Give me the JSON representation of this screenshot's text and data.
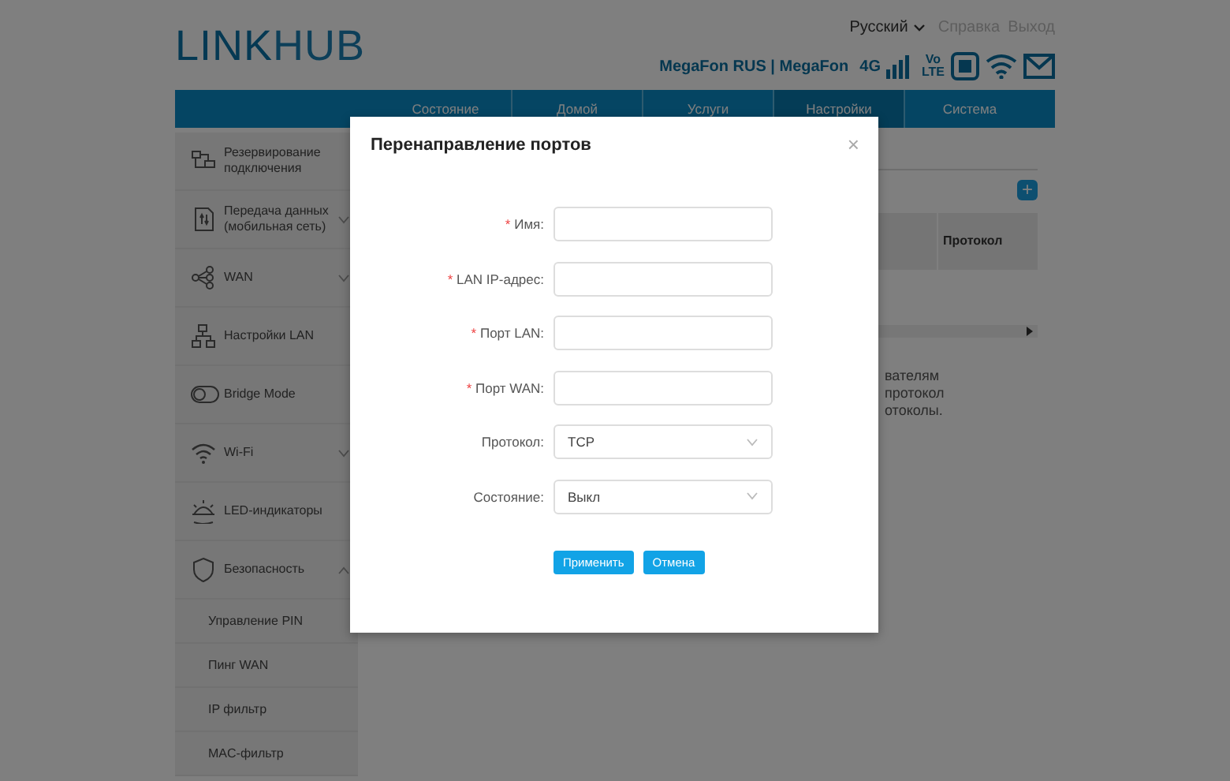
{
  "header": {
    "logo_bold": "LINK",
    "logo_light": "HUB",
    "language": "Русский",
    "links": [
      "Справка",
      "Выход"
    ],
    "operator": "MegaFon RUS | MegaFon",
    "network": "4G",
    "volte_top": "Vo",
    "volte_bottom": "LTE"
  },
  "nav": [
    {
      "label": "Состояние",
      "selected": false
    },
    {
      "label": "Домой",
      "selected": false
    },
    {
      "label": "Услуги",
      "selected": false
    },
    {
      "label": "Настройки",
      "selected": true
    },
    {
      "label": "Система",
      "selected": false
    }
  ],
  "sidebar": {
    "items": [
      {
        "label": "Резервирование подключения",
        "kind": "plain"
      },
      {
        "label": "Передача данных (мобильная сеть)",
        "kind": "expandable",
        "expanded": false
      },
      {
        "label": "WAN",
        "kind": "expandable",
        "expanded": false
      },
      {
        "label": "Настройки LAN",
        "kind": "plain"
      },
      {
        "label": "Bridge Mode",
        "kind": "plain"
      },
      {
        "label": "Wi-Fi",
        "kind": "expandable",
        "expanded": false
      },
      {
        "label": "LED-индикаторы",
        "kind": "plain"
      },
      {
        "label": "Безопасность",
        "kind": "expandable",
        "expanded": true,
        "children": [
          {
            "label": "Управление PIN"
          },
          {
            "label": "Пинг WAN"
          },
          {
            "label": "IP фильтр"
          },
          {
            "label": "MAC-фильтр"
          }
        ]
      }
    ]
  },
  "content": {
    "add_button": "+",
    "table": {
      "columns": [
        "Протокол"
      ]
    },
    "note_lines": [
      "вателям",
      "протокол",
      "отоколы."
    ]
  },
  "dialog": {
    "title": "Перенаправление портов",
    "close": "×",
    "fields": [
      {
        "label": "Имя:",
        "required_mark": "*",
        "kind": "text"
      },
      {
        "label": "LAN IP-адрес:",
        "required_mark": "*",
        "kind": "text"
      },
      {
        "label": "Порт LAN:",
        "required_mark": "*",
        "kind": "text"
      },
      {
        "label": "Порт WAN:",
        "required_mark": "*",
        "kind": "text"
      },
      {
        "label": "Протокол:",
        "kind": "select",
        "value": "TCP"
      },
      {
        "label": "Состояние:",
        "kind": "select",
        "value": "Выкл"
      }
    ],
    "buttons": [
      "Применить",
      "Отмена"
    ]
  }
}
